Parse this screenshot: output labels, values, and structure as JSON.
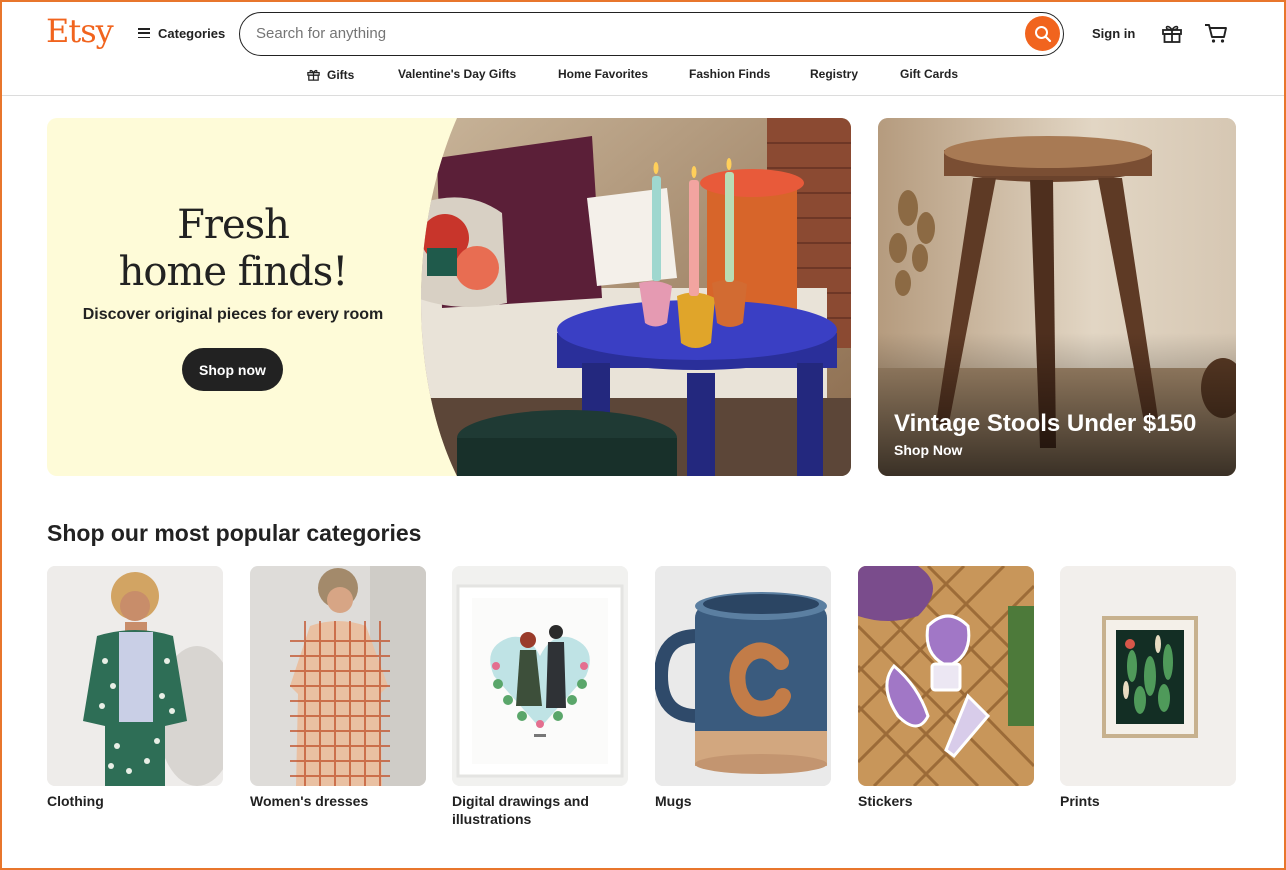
{
  "header": {
    "logo": "Etsy",
    "categories_label": "Categories",
    "search_placeholder": "Search for anything",
    "signin_label": "Sign in"
  },
  "nav": {
    "items": [
      "Gifts",
      "Valentine's Day Gifts",
      "Home Favorites",
      "Fashion Finds",
      "Registry",
      "Gift Cards"
    ]
  },
  "hero": {
    "title_line1": "Fresh",
    "title_line2": "home finds!",
    "subtitle": "Discover original pieces for every room",
    "cta": "Shop now"
  },
  "promo": {
    "title": "Vintage Stools Under $150",
    "cta": "Shop Now"
  },
  "popular": {
    "title": "Shop our most popular categories",
    "items": [
      {
        "label": "Clothing"
      },
      {
        "label": "Women's dresses"
      },
      {
        "label": "Digital drawings and illustrations"
      },
      {
        "label": "Mugs"
      },
      {
        "label": "Stickers"
      },
      {
        "label": "Prints"
      }
    ]
  },
  "colors": {
    "brand": "#f1641e",
    "hero_bg": "#fefbd8",
    "frame": "#e8762c"
  }
}
